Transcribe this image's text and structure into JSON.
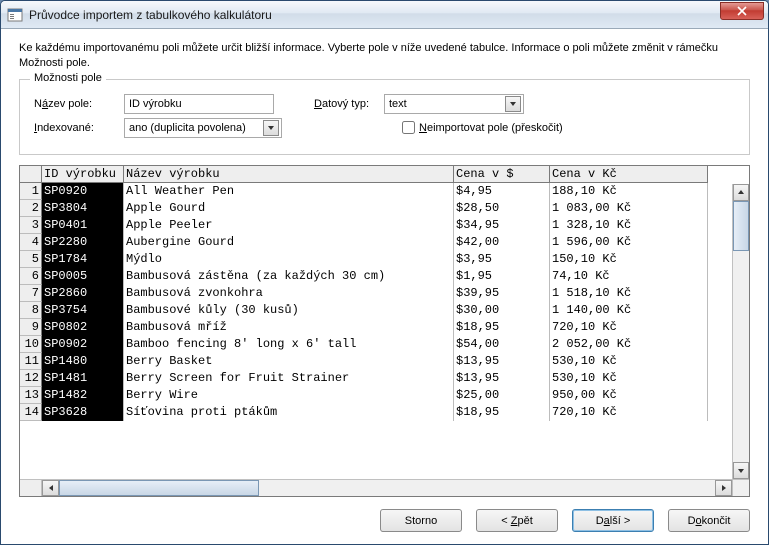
{
  "window": {
    "title": "Průvodce importem z tabulkového kalkulátoru"
  },
  "intro": "Ke každému importovanému poli můžete určit bližší informace. Vyberte pole v níže uvedené tabulce. Informace o poli můžete změnit v rámečku Možnosti pole.",
  "options": {
    "legend": "Možnosti pole",
    "name_label": "Název pole:",
    "name_value": "ID výrobku",
    "index_label": "Indexované:",
    "index_value": "ano (duplicita povolena)",
    "type_label": "Datový typ:",
    "type_value": "text",
    "skip_label": "Neimportovat pole (přeskočit)"
  },
  "grid": {
    "headers": [
      "ID výrobku",
      "Název výrobku",
      "Cena v $",
      "Cena v Kč"
    ],
    "rows": [
      {
        "n": "1",
        "id": "SP0920",
        "name": "All Weather Pen",
        "usd": "$4,95",
        "kc": "188,10 Kč"
      },
      {
        "n": "2",
        "id": "SP3804",
        "name": "Apple Gourd",
        "usd": "$28,50",
        "kc": "1 083,00 Kč"
      },
      {
        "n": "3",
        "id": "SP0401",
        "name": "Apple Peeler",
        "usd": "$34,95",
        "kc": "1 328,10 Kč"
      },
      {
        "n": "4",
        "id": "SP2280",
        "name": "Aubergine Gourd",
        "usd": "$42,00",
        "kc": "1 596,00 Kč"
      },
      {
        "n": "5",
        "id": "SP1784",
        "name": "Mýdlo",
        "usd": "$3,95",
        "kc": "150,10 Kč"
      },
      {
        "n": "6",
        "id": "SP0005",
        "name": "Bambusová zástěna (za každých 30 cm)",
        "usd": "$1,95",
        "kc": "74,10 Kč"
      },
      {
        "n": "7",
        "id": "SP2860",
        "name": "Bambusová zvonkohra",
        "usd": "$39,95",
        "kc": "1 518,10 Kč"
      },
      {
        "n": "8",
        "id": "SP3754",
        "name": "Bambusové kůly (30 kusů)",
        "usd": "$30,00",
        "kc": "1 140,00 Kč"
      },
      {
        "n": "9",
        "id": "SP0802",
        "name": "Bambusová mříž",
        "usd": "$18,95",
        "kc": "720,10 Kč"
      },
      {
        "n": "10",
        "id": "SP0902",
        "name": "Bamboo fencing 8' long x 6' tall",
        "usd": "$54,00",
        "kc": "2 052,00 Kč"
      },
      {
        "n": "11",
        "id": "SP1480",
        "name": "Berry Basket",
        "usd": "$13,95",
        "kc": "530,10 Kč"
      },
      {
        "n": "12",
        "id": "SP1481",
        "name": "Berry Screen for Fruit Strainer",
        "usd": "$13,95",
        "kc": "530,10 Kč"
      },
      {
        "n": "13",
        "id": "SP1482",
        "name": "Berry Wire",
        "usd": "$25,00",
        "kc": "950,00 Kč"
      },
      {
        "n": "14",
        "id": "SP3628",
        "name": "Síťovina proti ptákům",
        "usd": "$18,95",
        "kc": "720,10 Kč"
      }
    ]
  },
  "buttons": {
    "cancel": "Storno",
    "back": "< Zpět",
    "next": "Další >",
    "finish": "Dokončit"
  }
}
